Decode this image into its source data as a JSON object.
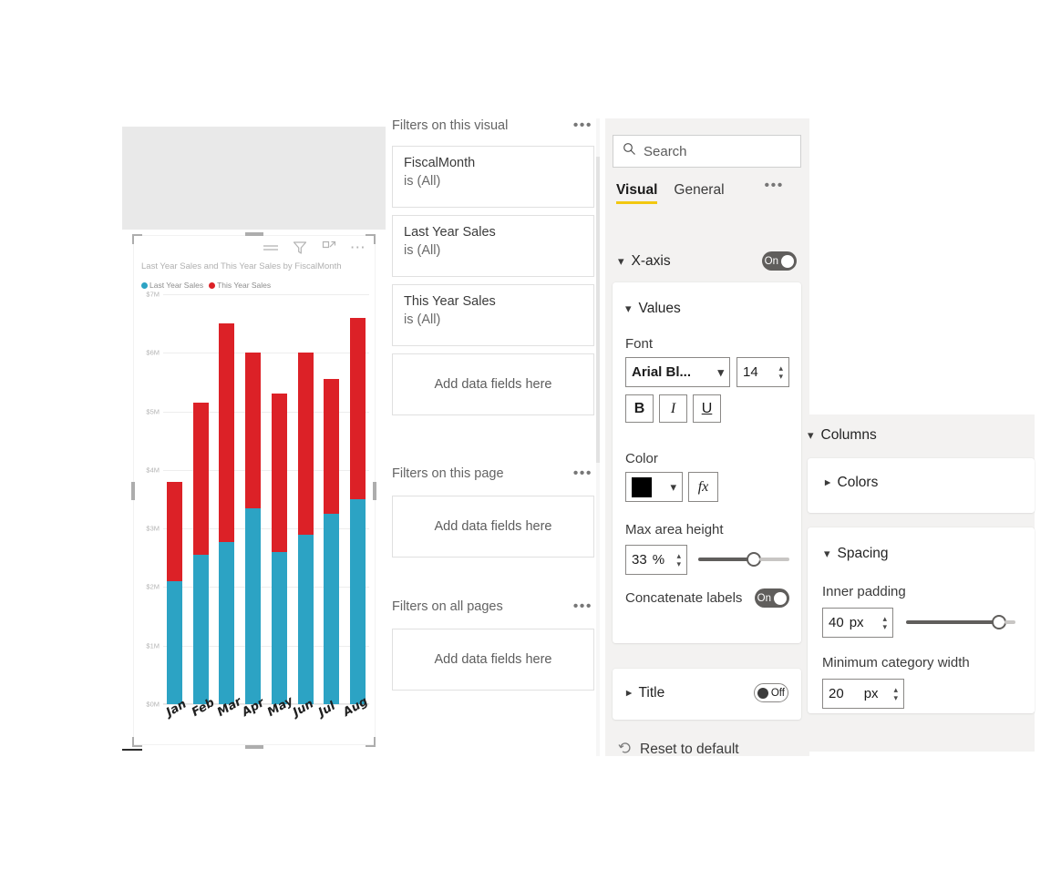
{
  "report": {
    "visual_header_icons": [
      "drill-menu-icon",
      "filter-icon",
      "focus-mode-icon",
      "more-options-icon"
    ]
  },
  "chart_data": {
    "type": "bar",
    "subtype": "stacked-column",
    "title": "Last Year Sales and This Year Sales by FiscalMonth",
    "xlabel": "FiscalMonth",
    "ylabel": "",
    "categories": [
      "Jan",
      "Feb",
      "Mar",
      "Apr",
      "May",
      "Jun",
      "Jul",
      "Aug"
    ],
    "series": [
      {
        "name": "Last Year Sales",
        "color": "#2CA3C4",
        "values": [
          2.1,
          2.55,
          2.77,
          3.35,
          2.6,
          2.9,
          3.25,
          3.5
        ]
      },
      {
        "name": "This Year Sales",
        "color": "#DC2127",
        "values": [
          1.7,
          2.6,
          3.73,
          2.65,
          2.7,
          3.1,
          2.3,
          3.1
        ]
      }
    ],
    "totals": [
      3.8,
      5.15,
      6.5,
      6.0,
      5.3,
      6.0,
      5.55,
      6.6
    ],
    "ylim": [
      0,
      7
    ],
    "ytick_labels": [
      "$0M",
      "$1M",
      "$2M",
      "$3M",
      "$4M",
      "$5M",
      "$6M",
      "$7M"
    ],
    "ytick_values": [
      0,
      1,
      2,
      3,
      4,
      5,
      6,
      7
    ],
    "grid": true,
    "legend_position": "top-left",
    "units": "millions of dollars"
  },
  "filters_pane": {
    "visual_section": {
      "title": "Filters on this visual",
      "more_label": "•••",
      "cards": [
        {
          "field": "FiscalMonth",
          "condition": "is (All)"
        },
        {
          "field": "Last Year Sales",
          "condition": "is (All)"
        },
        {
          "field": "This Year Sales",
          "condition": "is (All)"
        }
      ],
      "dropzone": "Add data fields here"
    },
    "page_section": {
      "title": "Filters on this page",
      "dropzone": "Add data fields here"
    },
    "all_pages_section": {
      "title": "Filters on all pages",
      "dropzone": "Add data fields here"
    }
  },
  "format_pane": {
    "search": {
      "placeholder": "Search",
      "value": ""
    },
    "tabs": [
      {
        "label": "Visual",
        "active": true
      },
      {
        "label": "General",
        "active": false
      }
    ],
    "more_label": "•••",
    "xaxis": {
      "label": "X-axis",
      "toggle": {
        "state": "On"
      },
      "values_section": {
        "label": "Values",
        "font_label": "Font",
        "font_family": "Arial Bl...",
        "font_size": "14",
        "bold_label": "B",
        "italic_label": "I",
        "underline_label": "U",
        "color_label": "Color",
        "color_value": "#000000",
        "fx_label": "fx",
        "max_area_height_label": "Max area height",
        "max_area_height_value": "33",
        "max_area_height_unit": "%",
        "max_area_height_percent": 55,
        "concatenate_label": "Concatenate labels",
        "concatenate_toggle": {
          "state": "On"
        }
      },
      "title_section": {
        "label": "Title",
        "toggle": {
          "state": "Off"
        }
      }
    },
    "reset_label": "Reset to default"
  },
  "columns_pane": {
    "header": "Columns",
    "colors_section": {
      "label": "Colors"
    },
    "spacing_section": {
      "label": "Spacing",
      "inner_padding_label": "Inner padding",
      "inner_padding_value": "40",
      "inner_padding_unit": "px",
      "inner_padding_percent": 80,
      "min_category_width_label": "Minimum category width",
      "min_category_width_value": "20",
      "min_category_width_unit": "px"
    }
  }
}
